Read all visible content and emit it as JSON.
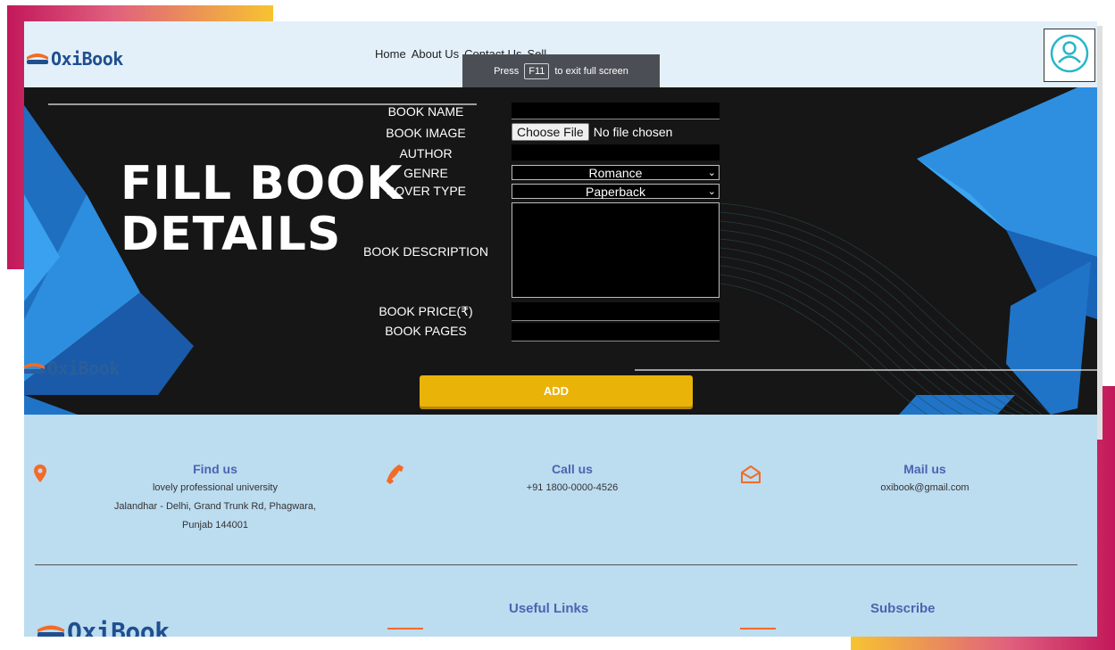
{
  "header": {
    "logo_text": "OxiBook",
    "nav": [
      "Home",
      "About Us",
      "Contact Us",
      "Sell"
    ],
    "fullscreen_notice": {
      "press": "Press",
      "key": "F11",
      "rest": "to exit full screen"
    }
  },
  "hero": {
    "title_line1": "FILL BOOK",
    "title_line2": "DETAILS",
    "logo_text": "OxiBook"
  },
  "form": {
    "book_name_label": "BOOK NAME",
    "book_image_label": "BOOK IMAGE",
    "file_button": "Choose File",
    "file_status": "No file chosen",
    "author_label": "AUTHOR",
    "genre_label": "GENRE",
    "genre_value": "Romance",
    "cover_label": "COVER TYPE",
    "cover_value": "Paperback",
    "description_label": "BOOK DESCRIPTION",
    "price_label": "BOOK PRICE(₹)",
    "pages_label": "BOOK PAGES",
    "add_button": "ADD"
  },
  "footer": {
    "find": {
      "title": "Find us",
      "line1": "lovely professional university",
      "line2": "Jalandhar - Delhi, Grand Trunk Rd, Phagwara,",
      "line3": "Punjab 144001"
    },
    "call": {
      "title": "Call us",
      "phone": "+91 1800-0000-4526"
    },
    "mail": {
      "title": "Mail us",
      "email": "oxibook@gmail.com"
    },
    "useful_links": "Useful Links",
    "subscribe": "Subscribe",
    "logo_text": "OxiBook"
  },
  "colors": {
    "accent_orange": "#f36b26",
    "button_yellow": "#eab308",
    "heading_blue": "#4b64b0"
  }
}
